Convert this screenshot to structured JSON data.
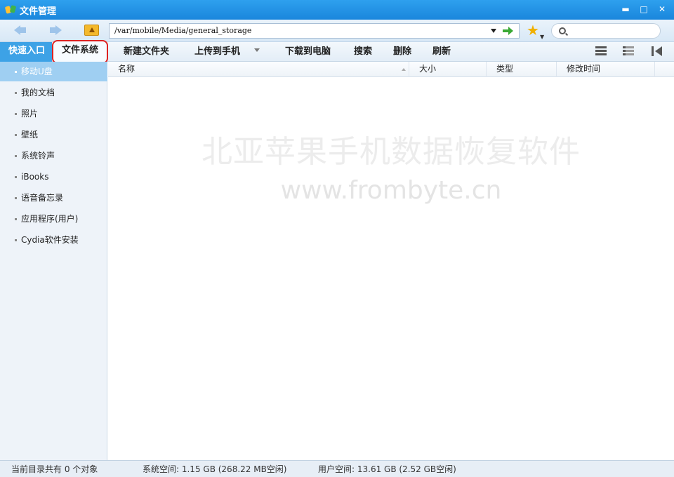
{
  "window": {
    "title": "文件管理"
  },
  "navbar": {
    "path": "/var/mobile/Media/general_storage",
    "search_placeholder": ""
  },
  "tabs": {
    "quick_entry": "快速入口",
    "file_system": "文件系统"
  },
  "toolbar": {
    "new_folder": "新建文件夹",
    "upload": "上传到手机",
    "download": "下载到电脑",
    "search": "搜索",
    "delete": "删除",
    "refresh": "刷新"
  },
  "sidebar": {
    "items": [
      {
        "label": "移动U盘",
        "active": true
      },
      {
        "label": "我的文档"
      },
      {
        "label": "照片"
      },
      {
        "label": "壁纸"
      },
      {
        "label": "系统铃声"
      },
      {
        "label": "iBooks"
      },
      {
        "label": "语音备忘录"
      },
      {
        "label": "应用程序(用户)"
      },
      {
        "label": "Cydia软件安装"
      }
    ]
  },
  "table": {
    "columns": [
      "名称",
      "大小",
      "类型",
      "修改时间"
    ]
  },
  "watermark": {
    "line1": "北亚苹果手机数据恢复软件",
    "line2": "www.frombyte.cn"
  },
  "status": {
    "object_count": "当前目录共有 0 个对象",
    "system_space": "系统空间: 1.15 GB (268.22 MB空闲)",
    "user_space": "用户空间: 13.61 GB (2.52 GB空闲)"
  },
  "colors": {
    "titlebar": "#1a86dc",
    "accent": "#3da2e6",
    "highlight": "#d22222"
  }
}
